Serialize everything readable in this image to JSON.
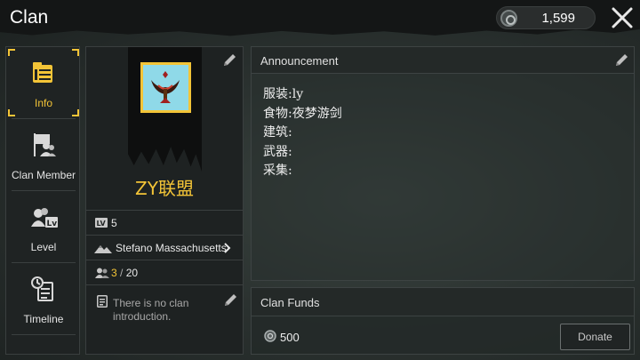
{
  "header": {
    "title": "Clan",
    "currency_value": "1,599"
  },
  "sidebar": {
    "items": [
      {
        "label": "Info",
        "icon": "info-icon",
        "active": true
      },
      {
        "label": "Clan Member",
        "icon": "clan-member-icon"
      },
      {
        "label": "Level",
        "icon": "level-icon"
      },
      {
        "label": "Timeline",
        "icon": "timeline-icon"
      }
    ]
  },
  "clan": {
    "name": "ZY联盟",
    "level_badge": "LV",
    "level": "5",
    "leader": "Stefano Massachusetts",
    "members_current": "3",
    "members_sep": " / ",
    "members_max": "20",
    "intro": "There is no clan introduction."
  },
  "announcement": {
    "title": "Announcement",
    "lines": [
      "服装:ly",
      "食物:夜梦游剑",
      "建筑:",
      "武器:",
      "采集:"
    ]
  },
  "funds": {
    "title": "Clan Funds",
    "value": "500",
    "donate_label": "Donate"
  },
  "colors": {
    "accent": "#f3c437",
    "panel": "#1e2222",
    "border": "#3a3f3f"
  }
}
